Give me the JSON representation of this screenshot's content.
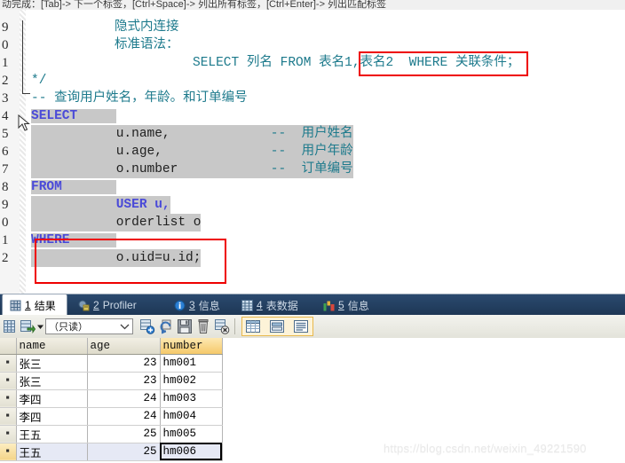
{
  "hint_bar": {
    "text": "动完成：[Tab]-> 下一个标签，[Ctrl+Space]-> 列出所有标签，[Ctrl+Enter]-> 列出匹配标签"
  },
  "editor": {
    "line_numbers": [
      "9",
      "0",
      "1",
      "2",
      "3",
      "4",
      "5",
      "6",
      "7",
      "8",
      "9",
      "0",
      "1",
      "2"
    ],
    "lines": [
      {
        "n": "9",
        "indent": 12,
        "text": "隐式内连接",
        "kind": "comment"
      },
      {
        "n": "0",
        "indent": 12,
        "text": "标准语法：",
        "kind": "comment"
      },
      {
        "n": "1",
        "indent": 23,
        "text": "SELECT 列名 FROM 表名1,表名2 WHERE 关联条件；",
        "kind": "comment"
      },
      {
        "n": "2",
        "indent": 0,
        "text": "*/",
        "kind": "comment"
      },
      {
        "n": "3",
        "indent": 0,
        "text": "-- 查询用户姓名，年龄。和订单编号",
        "kind": "comment"
      },
      {
        "n": "4",
        "indent": 0,
        "text": "SELECT",
        "kind": "keyword"
      },
      {
        "n": "5",
        "indent": 8,
        "text": "u.name,",
        "kind": "code",
        "trail": "--  用户姓名"
      },
      {
        "n": "6",
        "indent": 8,
        "text": "u.age,",
        "kind": "code",
        "trail": "--  用户年龄"
      },
      {
        "n": "7",
        "indent": 8,
        "text": "o.number",
        "kind": "code",
        "trail": "--  订单编号"
      },
      {
        "n": "8",
        "indent": 0,
        "text": "FROM",
        "kind": "keyword"
      },
      {
        "n": "9",
        "indent": 8,
        "text": "USER u,",
        "kind": "code"
      },
      {
        "n": "0",
        "indent": 8,
        "text": "orderlist o",
        "kind": "code"
      },
      {
        "n": "1",
        "indent": 0,
        "text": "WHERE",
        "kind": "keyword"
      },
      {
        "n": "2",
        "indent": 8,
        "text": "o.uid=u.id;",
        "kind": "code"
      }
    ],
    "tokens": {
      "select_kw": "SELECT",
      "from_kw": "FROM",
      "where_kw": "WHERE",
      "user_kw": "USER",
      "syntax_select": "SELECT",
      "syntax_collist": "列名",
      "syntax_from": "FROM",
      "syntax_tables": "表名1,表名2  WHERE",
      "syntax_cond": "关联条件；",
      "cmt_title": "隐式内连接",
      "cmt_std": "标准语法：",
      "cmt_end": "*/",
      "cmt_query": "-- 查询用户姓名，年龄。和订单编号",
      "col_name": "u.name,",
      "col_age": "u.age,",
      "col_number": "o.number",
      "cmt_name": "--  用户姓名",
      "cmt_age": "--  用户年龄",
      "cmt_number": "--  订单编号",
      "tbl_user": "USER u,",
      "tbl_order": "orderlist o",
      "cond": "o.uid=u.id;"
    },
    "annotation_color": "#ee0000",
    "selection_color": "#c8c8c8"
  },
  "result_tabs": [
    {
      "num": "1",
      "label": "结果",
      "icon": "grid-icon",
      "active": true
    },
    {
      "num": "2",
      "label": "Profiler",
      "icon": "profiler-icon",
      "active": false
    },
    {
      "num": "3",
      "label": "信息",
      "icon": "info-icon",
      "active": false
    },
    {
      "num": "4",
      "label": "表数据",
      "icon": "table-icon",
      "active": false
    },
    {
      "num": "5",
      "label": "信息",
      "icon": "chart-icon",
      "active": false
    }
  ],
  "grid_toolbar": {
    "mode_value": "（只读）",
    "buttons": [
      {
        "name": "grid-icon",
        "title": "网格"
      },
      {
        "name": "export-icon",
        "title": "导出"
      },
      {
        "name": "dropdown-arrow-icon",
        "title": "更多"
      },
      {
        "name": "add-record-icon",
        "title": "新增记录"
      },
      {
        "name": "refresh-icon",
        "title": "刷新"
      },
      {
        "name": "save-icon",
        "title": "保存"
      },
      {
        "name": "delete-icon",
        "title": "删除记录"
      },
      {
        "name": "cancel-edit-icon",
        "title": "取消编辑"
      },
      {
        "name": "view-grid-icon",
        "title": "网格视图"
      },
      {
        "name": "view-form-icon",
        "title": "表单视图"
      },
      {
        "name": "view-text-icon",
        "title": "文本视图"
      }
    ]
  },
  "result_grid": {
    "columns": [
      "name",
      "age",
      "number"
    ],
    "highlight_column": "number",
    "rows": [
      {
        "name": "张三",
        "age": "23",
        "number": "hm001"
      },
      {
        "name": "张三",
        "age": "23",
        "number": "hm002"
      },
      {
        "name": "李四",
        "age": "24",
        "number": "hm003"
      },
      {
        "name": "李四",
        "age": "24",
        "number": "hm004"
      },
      {
        "name": "王五",
        "age": "25",
        "number": "hm005"
      },
      {
        "name": "王五",
        "age": "25",
        "number": "hm006"
      }
    ],
    "selected_row_index": 5,
    "focused_cell": "number"
  },
  "watermark": {
    "text": "https://blog.csdn.net/weixin_49221590"
  }
}
